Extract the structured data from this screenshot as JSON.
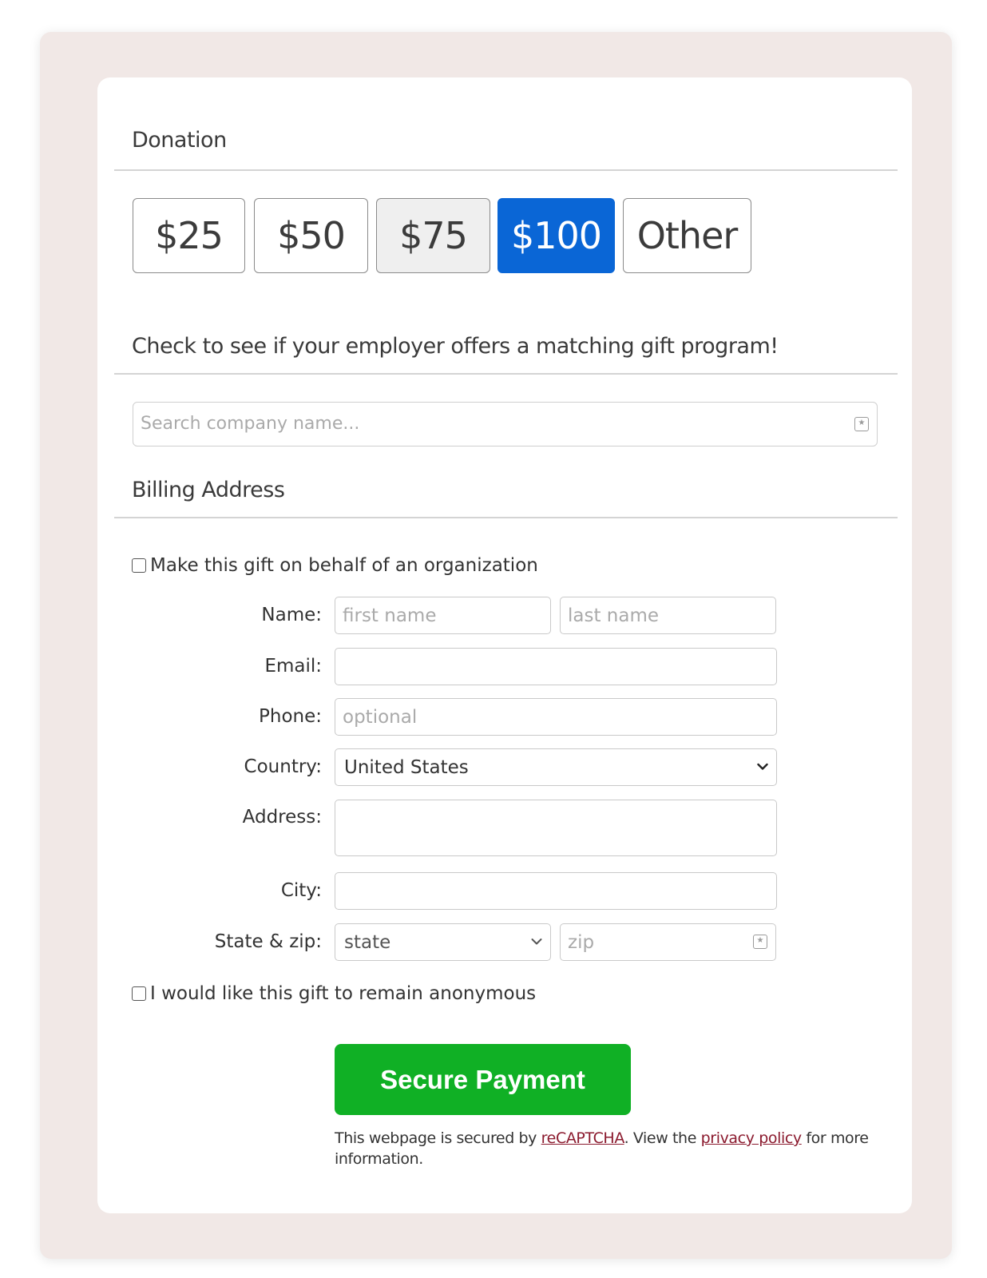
{
  "donation": {
    "title": "Donation",
    "amounts": [
      "$25",
      "$50",
      "$75",
      "$100",
      "Other"
    ],
    "selected": "$100"
  },
  "matching": {
    "title": "Check to see if your employer offers a matching gift program!",
    "search_placeholder": "Search company name..."
  },
  "billing": {
    "title": "Billing Address",
    "organization_checkbox": "Make this gift on behalf of an organization",
    "name_label": "Name:",
    "first_name_placeholder": "first name",
    "last_name_placeholder": "last name",
    "email_label": "Email:",
    "phone_label": "Phone:",
    "phone_placeholder": "optional",
    "country_label": "Country:",
    "country_value": "United States",
    "address_label": "Address:",
    "city_label": "City:",
    "state_zip_label": "State & zip:",
    "state_value": "state",
    "zip_placeholder": "zip",
    "anonymous_checkbox": "I would like this gift to remain anonymous"
  },
  "submit": {
    "label": "Secure Payment"
  },
  "footer": {
    "prefix": "This webpage is secured by ",
    "recaptcha_link": "reCAPTCHA",
    "middle": ". View the ",
    "privacy_link": "privacy policy",
    "suffix": " for more information."
  },
  "colors": {
    "selected_amount": "#0a66d6",
    "submit_button": "#10b025",
    "outer_background": "#f1e8e6",
    "link": "#8b1a2e"
  }
}
